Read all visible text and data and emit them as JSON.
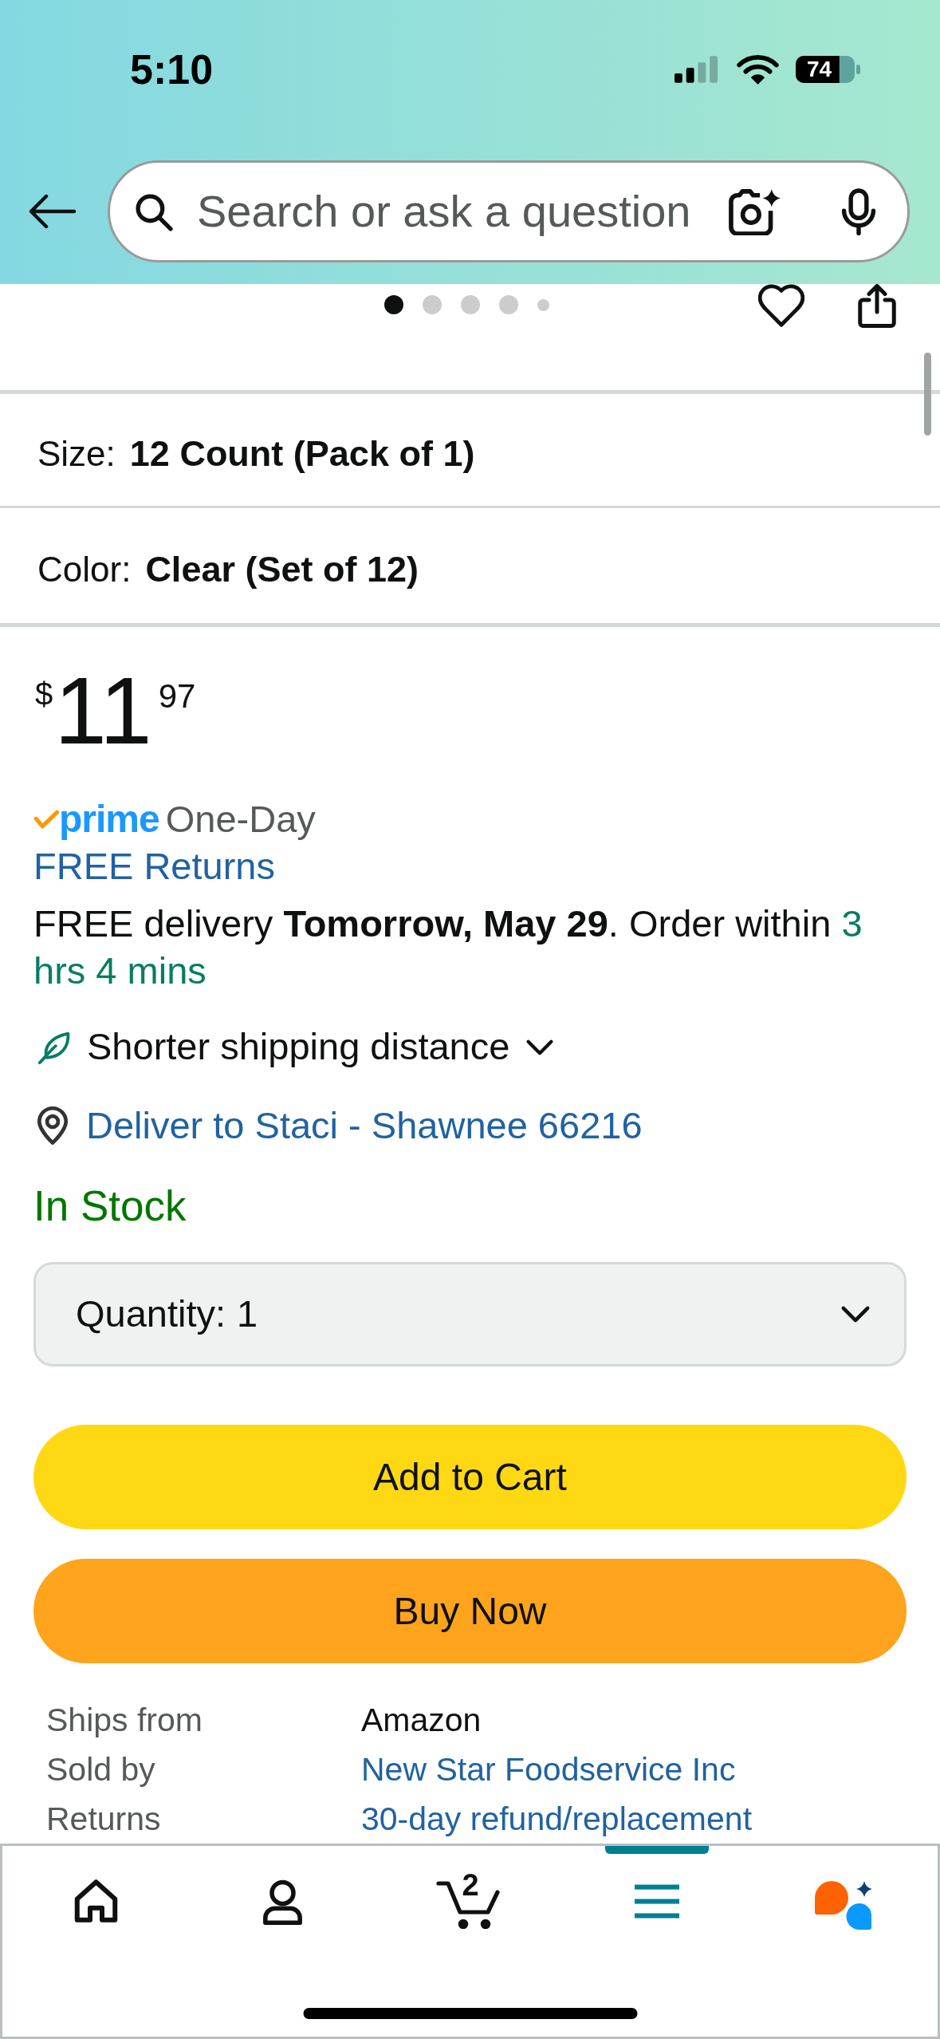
{
  "status_bar": {
    "time": "5:10",
    "battery": "74"
  },
  "search": {
    "placeholder": "Search or ask a question"
  },
  "carousel": {
    "dots": [
      {
        "selected": true
      },
      {
        "selected": false
      },
      {
        "selected": false
      },
      {
        "selected": false
      },
      {
        "selected": false
      }
    ]
  },
  "variations": [
    {
      "label": "Size:",
      "value": "12 Count (Pack of 1)"
    },
    {
      "label": "Color:",
      "value": "Clear (Set of 12)"
    }
  ],
  "price": {
    "currency": "$",
    "whole": "11",
    "fraction": "97"
  },
  "delivery": {
    "prime": "prime",
    "speed": "One-Day",
    "returns_link": "FREE Returns",
    "message": "FREE delivery **Tomorrow, May 29**. Order within",
    "countdown": "3 hrs 4 mins",
    "shipping_note": {
      "label": "Shorter shipping distance",
      "expanded": false
    },
    "deliver_to": "Deliver to Staci - Shawnee 66216"
  },
  "availability": "In Stock",
  "quantity": {
    "label": "Quantity:",
    "value": "1"
  },
  "buttons": [
    {
      "kind": "cart",
      "label": "Add to Cart"
    },
    {
      "kind": "buy",
      "label": "Buy Now"
    }
  ],
  "seller_info": [
    {
      "label": "Ships from",
      "value": "Amazon",
      "kind": "text"
    },
    {
      "label": "Sold by",
      "value": "New Star Foodservice Inc",
      "kind": "link"
    },
    {
      "label": "Returns",
      "value": "30-day refund/replacement",
      "kind": "link"
    }
  ],
  "tab_bar": [
    {
      "kind": "home",
      "selected": false
    },
    {
      "kind": "account",
      "selected": false
    },
    {
      "kind": "cart",
      "selected": false,
      "count": "2"
    },
    {
      "kind": "menu",
      "selected": true
    },
    {
      "kind": "assistant",
      "selected": false
    }
  ]
}
